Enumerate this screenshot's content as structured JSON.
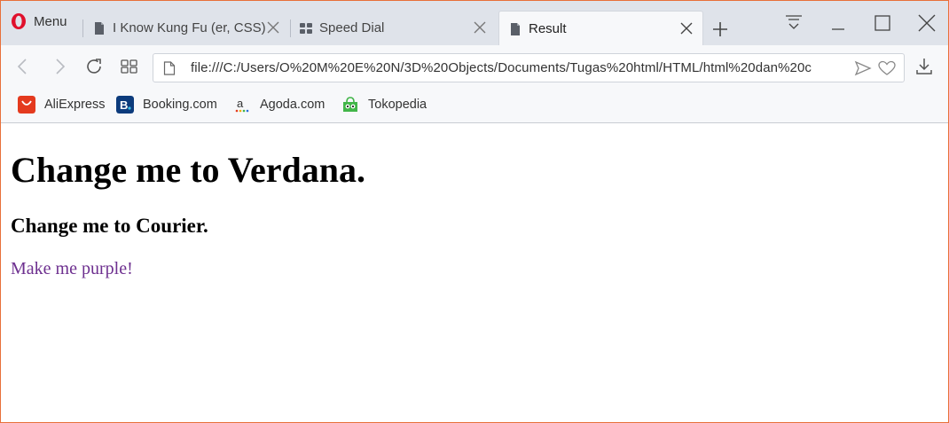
{
  "browser": {
    "menu_label": "Menu",
    "tabs": [
      {
        "title": "I Know Kung Fu (er, CSS)",
        "icon": "document-icon",
        "active": false
      },
      {
        "title": "Speed Dial",
        "icon": "speed-dial-icon",
        "active": false
      },
      {
        "title": "Result",
        "icon": "document-icon",
        "active": true
      }
    ],
    "address": "file:///C:/Users/O%20M%20E%20N/3D%20Objects/Documents/Tugas%20html/HTML/html%20dan%20c",
    "bookmarks": [
      {
        "label": "AliExpress",
        "icon": "aliexpress-icon",
        "color": "#e43a1e"
      },
      {
        "label": "Booking.com",
        "icon": "booking-icon",
        "color": "#0c3b7c"
      },
      {
        "label": "Agoda.com",
        "icon": "agoda-icon",
        "color": "#555555"
      },
      {
        "label": "Tokopedia",
        "icon": "tokopedia-icon",
        "color": "#42b549"
      }
    ],
    "accent_color": "#e8703a"
  },
  "page": {
    "heading1": "Change me to Verdana.",
    "heading2": "Change me to Courier.",
    "paragraph": "Make me purple!",
    "paragraph_color": "#6d2f8f"
  }
}
